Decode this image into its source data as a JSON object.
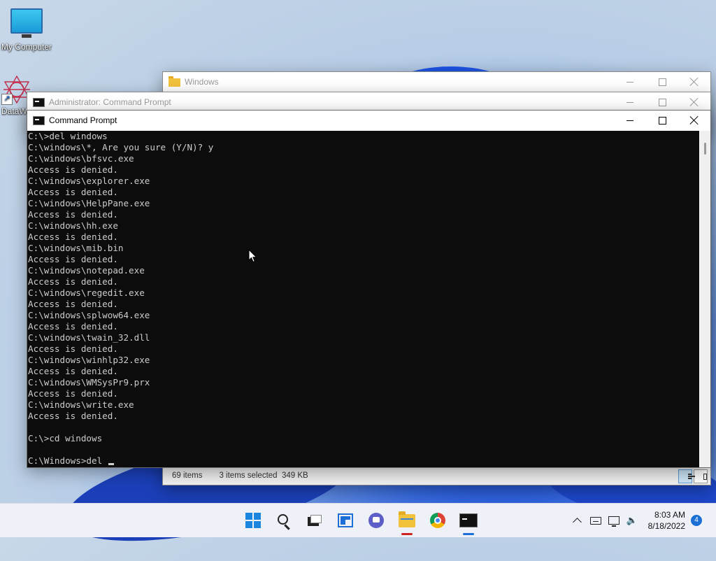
{
  "desktop": {
    "icons": [
      {
        "label": "My Computer"
      },
      {
        "label": "DataW"
      }
    ]
  },
  "windows": {
    "explorer": {
      "title": "Windows",
      "status": {
        "items": "69 items",
        "selected": "3 items selected  349 KB"
      }
    },
    "admin_cmd": {
      "title": "Administrator: Command Prompt"
    },
    "cmd": {
      "title": "Command Prompt",
      "console_text": "C:\\>del windows\nC:\\windows\\*, Are you sure (Y/N)? y\nC:\\windows\\bfsvc.exe\nAccess is denied.\nC:\\windows\\explorer.exe\nAccess is denied.\nC:\\windows\\HelpPane.exe\nAccess is denied.\nC:\\windows\\hh.exe\nAccess is denied.\nC:\\windows\\mib.bin\nAccess is denied.\nC:\\windows\\notepad.exe\nAccess is denied.\nC:\\windows\\regedit.exe\nAccess is denied.\nC:\\windows\\splwow64.exe\nAccess is denied.\nC:\\windows\\twain_32.dll\nAccess is denied.\nC:\\windows\\winhlp32.exe\nAccess is denied.\nC:\\windows\\WMSysPr9.prx\nAccess is denied.\nC:\\windows\\write.exe\nAccess is denied.\n\nC:\\>cd windows\n\nC:\\Windows>del "
    }
  },
  "taskbar": {
    "apps": [
      "start",
      "search",
      "task-view",
      "widgets",
      "chat",
      "file-explorer",
      "chrome",
      "command-prompt"
    ],
    "clock": {
      "time": "8:03 AM",
      "date": "8/18/2022"
    },
    "notification_count": "4"
  }
}
